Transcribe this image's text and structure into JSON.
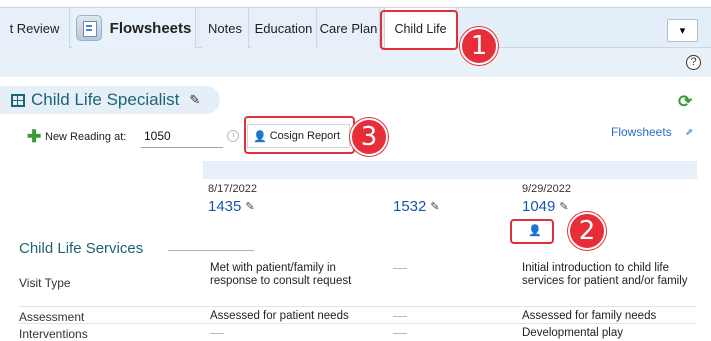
{
  "tabs": [
    {
      "label": "t Review"
    },
    {
      "label": "Flowsheets"
    },
    {
      "label": "Notes"
    },
    {
      "label": "Education"
    },
    {
      "label": "Care Plan"
    },
    {
      "label": "Child Life"
    }
  ],
  "dropdown_glyph": "▾",
  "help_glyph": "?",
  "section": {
    "title": "Child Life Specialist",
    "refresh_glyph": "⟳"
  },
  "toolbar": {
    "new_reading_label": "New Reading at:",
    "time_value": "1050",
    "cosign_label": "Cosign Report",
    "flowsheets_link": "Flowsheets"
  },
  "columns": [
    {
      "date": "8/17/2022",
      "time": "1435"
    },
    {
      "date": "",
      "time": "1532"
    },
    {
      "date": "9/29/2022",
      "time": "1049"
    }
  ],
  "services": {
    "heading": "Child Life Services",
    "rows": [
      {
        "label": "Visit Type",
        "col1": "Met with patient/family in response to consult request",
        "col2": "—",
        "col3": "Initial introduction to child life services for patient and/or family"
      },
      {
        "label": "Assessment",
        "col1": "Assessed for patient needs",
        "col2": "—",
        "col3": "Assessed for family needs"
      },
      {
        "label": "Interventions",
        "col1": "—",
        "col2": "—",
        "col3": "Developmental play"
      }
    ]
  },
  "callouts": [
    "1",
    "2",
    "3"
  ],
  "colors": {
    "accent_red": "#e62d38",
    "link_blue": "#1a56a8",
    "section_teal": "#1e6474"
  }
}
